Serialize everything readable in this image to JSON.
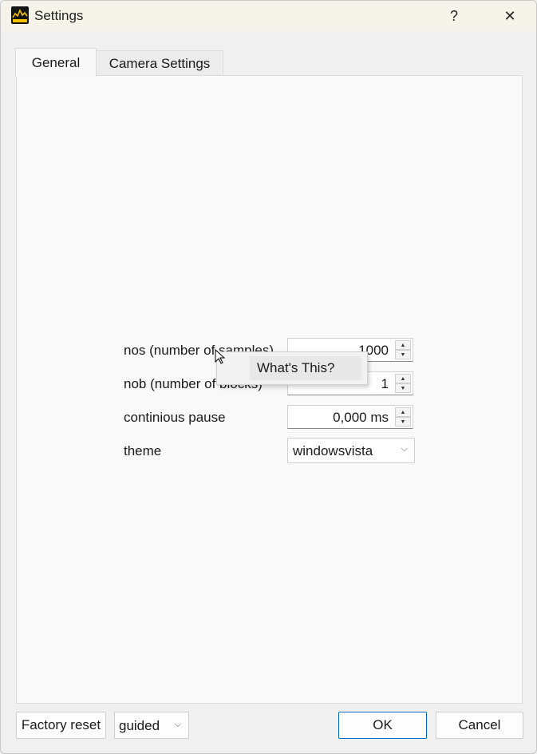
{
  "window": {
    "title": "Settings",
    "help_symbol": "?",
    "close_symbol": "✕",
    "icons": {
      "app": "oscilloscope-app-icon",
      "help": "help-icon",
      "close": "close-icon"
    }
  },
  "tabs": [
    {
      "label": "General",
      "selected": true
    },
    {
      "label": "Camera Settings",
      "selected": false
    }
  ],
  "form": {
    "nos": {
      "label": "nos (number of samples)",
      "value": "1000"
    },
    "nob": {
      "label": "nob (number of blocks)",
      "value": "1"
    },
    "pause": {
      "label": "continious pause",
      "value": "0,000 ms"
    },
    "theme": {
      "label": "theme",
      "value": "windowsvista"
    }
  },
  "context_menu": {
    "item": "What's This?"
  },
  "footer": {
    "factory_reset": "Factory reset",
    "mode_value": "guided",
    "ok": "OK",
    "cancel": "Cancel"
  },
  "colors": {
    "accent": "#0067c0",
    "titlebar": "#f6f4ea"
  }
}
